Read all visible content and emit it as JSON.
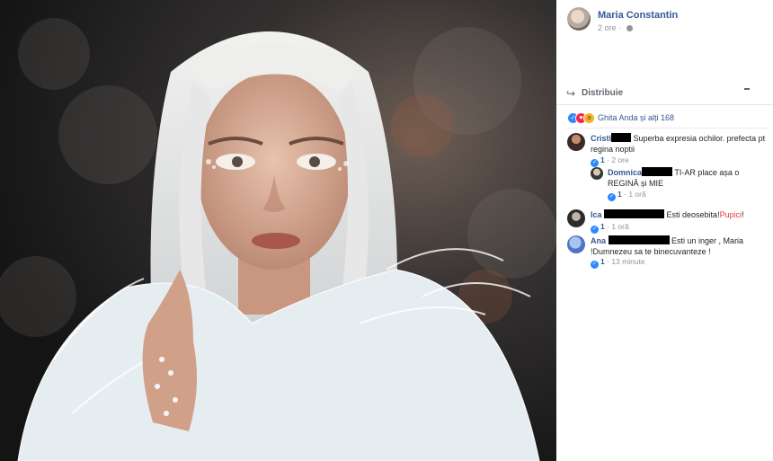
{
  "post": {
    "author": "Maria Constantin",
    "time": "2 ore",
    "separator": "·"
  },
  "actions": {
    "share_label": "Distribuie"
  },
  "reactions": {
    "summary": "Ghita Anda și alți 168"
  },
  "comments": [
    {
      "name": "Cristi",
      "text": " Superba expresia ochilor. prefecta pt regina noptii",
      "likes": "1",
      "time": "2 ore",
      "sep": "·"
    },
    {
      "name": "Domnica",
      "text": "TI-AR place așa o REGINĂ și MIE",
      "likes": "1",
      "time": "1 oră",
      "sep": "·"
    },
    {
      "name": "Ica",
      "text": " Esti deosebita!",
      "highlight": "Pupici",
      "tail": "!",
      "likes": "1",
      "time": "1 oră",
      "sep": "·"
    },
    {
      "name": "Ana",
      "text": " Esti un inger , Maria !Dumnezeu sa te binecuvanteze !",
      "likes": "1",
      "time": "13 minute",
      "sep": "·"
    }
  ],
  "colors": {
    "link": "#365899",
    "meta": "#90949c",
    "like": "#2d88ff",
    "highlight": "#e9353f"
  }
}
